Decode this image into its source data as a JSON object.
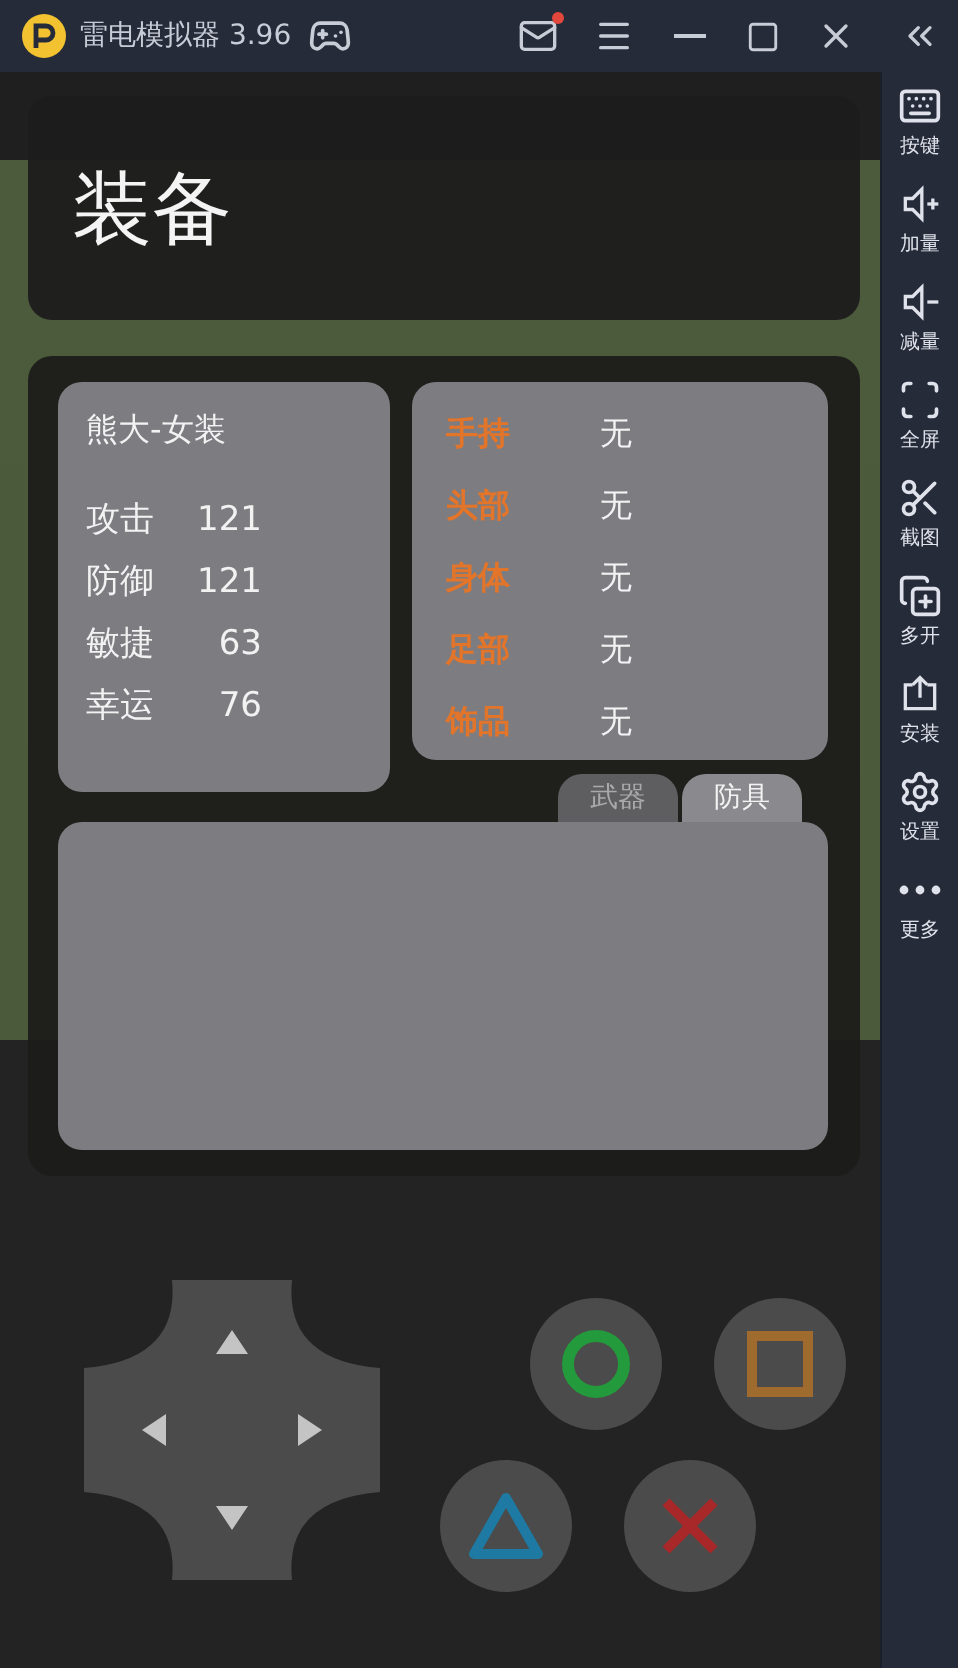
{
  "title_bar": {
    "app_title": "雷电模拟器 3.96",
    "has_new_mail": true
  },
  "sidebar": {
    "items": [
      {
        "label": "按键"
      },
      {
        "label": "加量"
      },
      {
        "label": "减量"
      },
      {
        "label": "全屏"
      },
      {
        "label": "截图"
      },
      {
        "label": "多开"
      },
      {
        "label": "安装"
      },
      {
        "label": "设置"
      },
      {
        "label": "更多"
      }
    ]
  },
  "game": {
    "title": "装备",
    "character": {
      "name": "熊大-女装",
      "stats": [
        {
          "label": "攻击",
          "value": "121"
        },
        {
          "label": "防御",
          "value": "121"
        },
        {
          "label": "敏捷",
          "value": "63"
        },
        {
          "label": "幸运",
          "value": "76"
        }
      ]
    },
    "equipment": [
      {
        "slot": "手持",
        "item": "无"
      },
      {
        "slot": "头部",
        "item": "无"
      },
      {
        "slot": "身体",
        "item": "无"
      },
      {
        "slot": "足部",
        "item": "无"
      },
      {
        "slot": "饰品",
        "item": "无"
      }
    ],
    "tabs": [
      {
        "label": "武器",
        "selected": false
      },
      {
        "label": "防具",
        "selected": true
      }
    ]
  }
}
